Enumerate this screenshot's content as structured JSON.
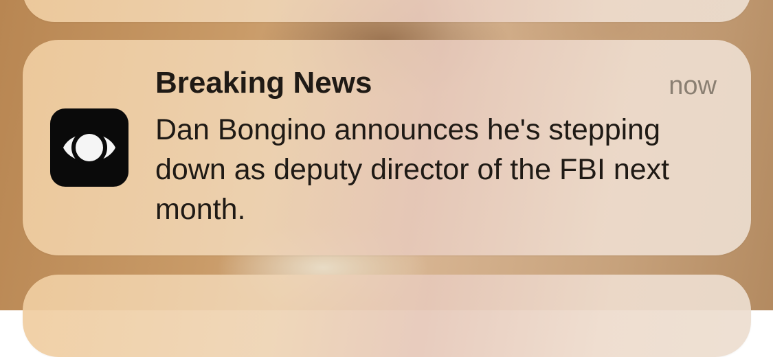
{
  "notifications": [
    {
      "app": "CBS News",
      "app_icon": "cbs-eye-icon",
      "title": "Breaking News",
      "time": "now",
      "body": "Dan Bongino announces he's stepping down as deputy director of the FBI next month."
    }
  ],
  "colors": {
    "card_background": "#EED5B8",
    "title_text": "#1F1A15",
    "time_text": "#8A7F72",
    "icon_background": "#0A0A0A"
  }
}
